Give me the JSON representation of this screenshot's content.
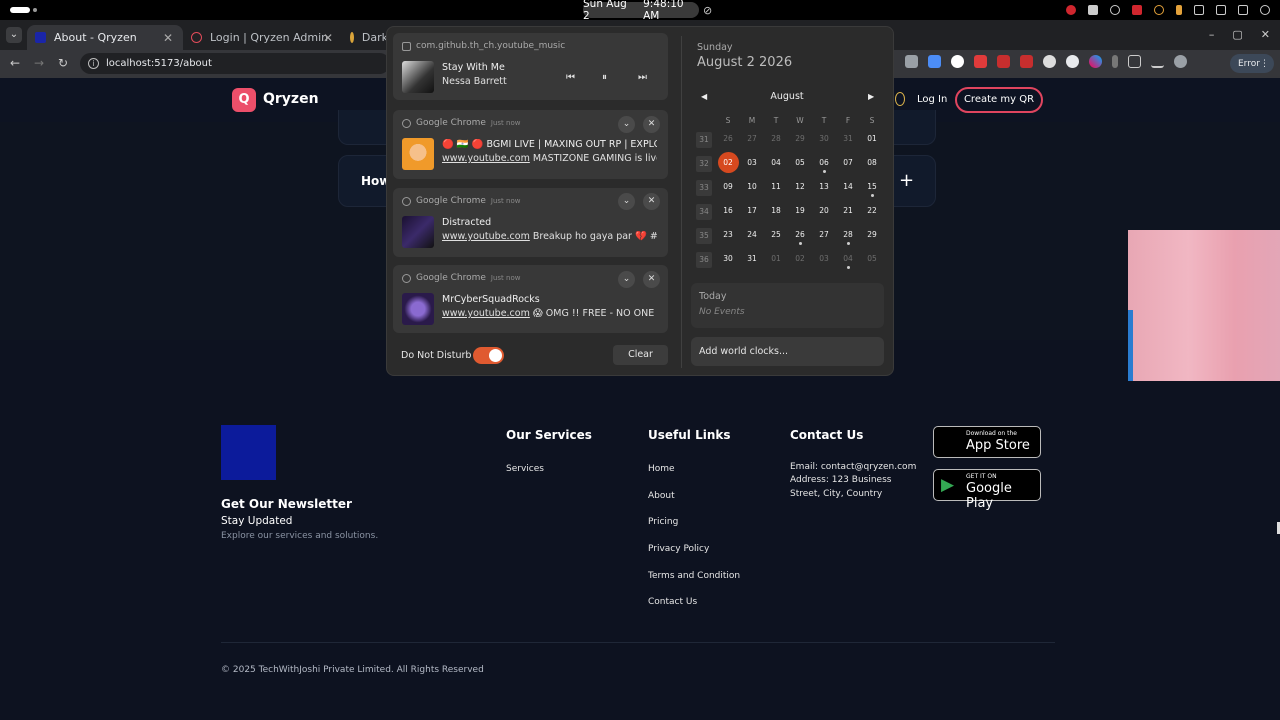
{
  "system_bar": {
    "date": "Sun Aug 2",
    "time": "9:48:10 AM"
  },
  "browser": {
    "tabs": [
      {
        "title": "About - Qryzen",
        "active": true
      },
      {
        "title": "Login | Qryzen Admin",
        "active": false
      },
      {
        "title": "Dark",
        "active": false
      }
    ],
    "url": "localhost:5173/about",
    "error_label": "Error",
    "accent": "#ec4f6a"
  },
  "site": {
    "logo_letter": "Q",
    "logo_text": "Qryzen",
    "login": "Log In",
    "create": "Create my QR",
    "faq_question": "How"
  },
  "footer": {
    "newsletter_title": "Get Our Newsletter",
    "newsletter_sub": "Stay Updated",
    "newsletter_desc": "Explore our services and solutions.",
    "services_title": "Our Services",
    "services_items": [
      "Services"
    ],
    "links_title": "Useful Links",
    "links": [
      "Home",
      "About",
      "Pricing",
      "Privacy Policy",
      "Terms and Condition",
      "Contact Us"
    ],
    "contact_title": "Contact Us",
    "contact_email": "Email: contact@qryzen.com",
    "contact_address_1": "Address: 123 Business",
    "contact_address_2": "Street, City, Country",
    "appstore_small": "Download on the",
    "appstore_big": "App Store",
    "googleplay_small": "GET IT ON",
    "googleplay_big": "Google Play",
    "copyright": "© 2025 TechWithJoshi Private Limited. All Rights Reserved"
  },
  "notifications": {
    "media": {
      "app": "com.github.th_ch.youtube_music",
      "title": "Stay With Me",
      "artist": "Nessa Barrett"
    },
    "items": [
      {
        "app": "Google Chrome",
        "time": "Just now",
        "line1": "🔴 🇮🇳 🔴 BGMI LIVE | MAXING OUT RP | EXPLO...",
        "site": "www.youtube.com",
        "line2": "MASTIZONE GAMING is live"
      },
      {
        "app": "Google Chrome",
        "time": "Just now",
        "line1": "Distracted",
        "site": "www.youtube.com",
        "line2": "Breakup ho gaya par 💔 #..."
      },
      {
        "app": "Google Chrome",
        "time": "Just now",
        "line1": "MrCyberSquadRocks",
        "site": "www.youtube.com",
        "line2": "😱 OMG !! FREE - NO ONE ..."
      }
    ],
    "dnd_label": "Do Not Disturb",
    "dnd_on": true,
    "clear": "Clear"
  },
  "calendar": {
    "weekday": "Sunday",
    "full_date": "August 2 2026",
    "month": "August",
    "headers": [
      "S",
      "M",
      "T",
      "W",
      "T",
      "F",
      "S"
    ],
    "weeks": [
      {
        "num": "31",
        "days": [
          "26",
          "27",
          "28",
          "29",
          "30",
          "31",
          "01"
        ]
      },
      {
        "num": "32",
        "days": [
          "02",
          "03",
          "04",
          "05",
          "06",
          "07",
          "08"
        ]
      },
      {
        "num": "33",
        "days": [
          "09",
          "10",
          "11",
          "12",
          "13",
          "14",
          "15"
        ]
      },
      {
        "num": "34",
        "days": [
          "16",
          "17",
          "18",
          "19",
          "20",
          "21",
          "22"
        ]
      },
      {
        "num": "35",
        "days": [
          "23",
          "24",
          "25",
          "26",
          "27",
          "28",
          "29"
        ]
      },
      {
        "num": "36",
        "days": [
          "30",
          "31",
          "01",
          "02",
          "03",
          "04",
          "05"
        ]
      }
    ],
    "today_label": "Today",
    "no_events": "No Events",
    "world_clocks": "Add world clocks...",
    "today_color": "#d6491f"
  }
}
